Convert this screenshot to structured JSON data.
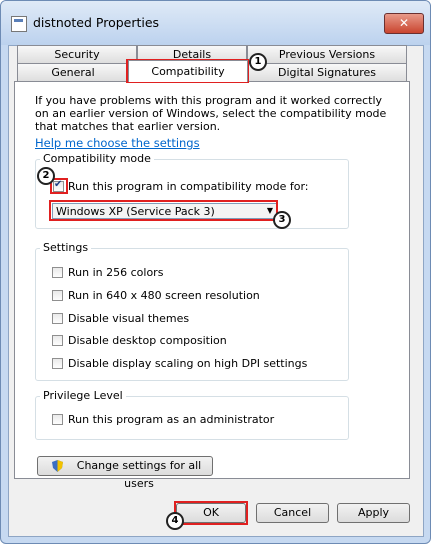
{
  "window": {
    "title": "distnoted Properties",
    "close_glyph": "✕"
  },
  "tabs": {
    "row1": [
      "Security",
      "Details",
      "Previous Versions"
    ],
    "row2": [
      "General",
      "Compatibility",
      "Digital Signatures"
    ],
    "active": "Compatibility"
  },
  "intro": "If you have problems with this program and it worked correctly on an earlier version of Windows, select the compatibility mode that matches that earlier version.",
  "help_link": "Help me choose the settings",
  "compat": {
    "group_label": "Compatibility mode",
    "checkbox_label": "Run this program in compatibility mode for:",
    "checked": true,
    "selected_mode": "Windows XP (Service Pack 3)"
  },
  "settings": {
    "group_label": "Settings",
    "items": [
      "Run in 256 colors",
      "Run in 640 x 480 screen resolution",
      "Disable visual themes",
      "Disable desktop composition",
      "Disable display scaling on high DPI settings"
    ]
  },
  "privilege": {
    "group_label": "Privilege Level",
    "item": "Run this program as an administrator"
  },
  "change_all_button": "Change settings for all users",
  "buttons": {
    "ok": "OK",
    "cancel": "Cancel",
    "apply": "Apply"
  },
  "markers": [
    "1",
    "2",
    "3",
    "4"
  ],
  "colors": {
    "highlight": "#e02020",
    "link": "#0066cc"
  },
  "icons": {
    "app": "app-icon",
    "shield": "uac-shield-icon",
    "dropdown": "chevron-down-icon"
  }
}
